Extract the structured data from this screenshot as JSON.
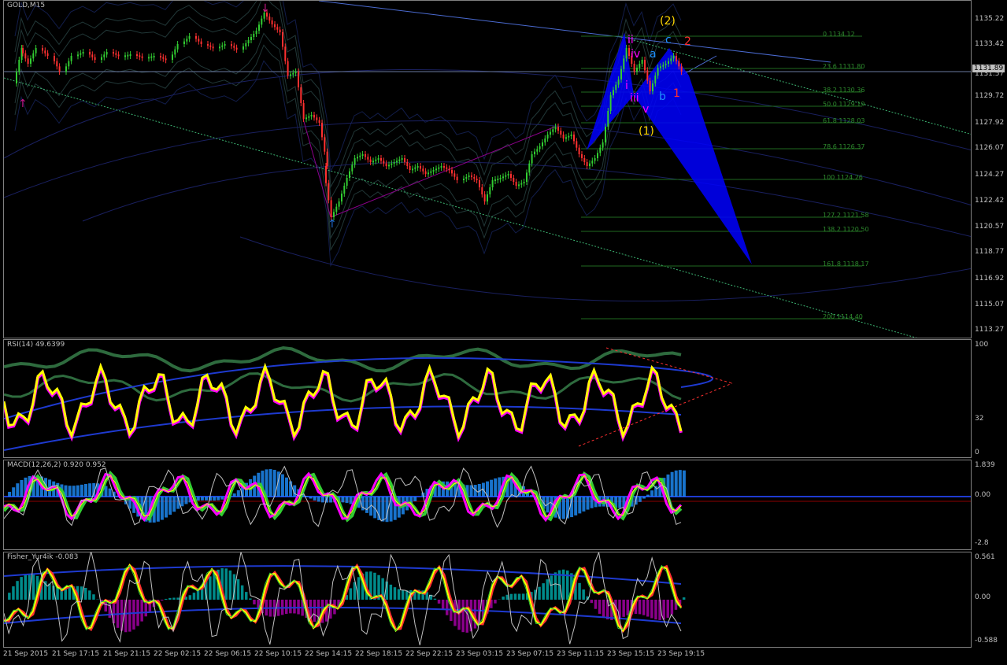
{
  "window": {
    "title": "GOLD,M15"
  },
  "current_price": "1131.89",
  "price_axis": [
    "1135.22",
    "1133.42",
    "1131.57",
    "1129.72",
    "1127.92",
    "1126.07",
    "1124.27",
    "1122.42",
    "1120.57",
    "1118.77",
    "1116.92",
    "1115.07",
    "1113.27"
  ],
  "fib_levels": [
    "0 1134.12",
    "23.6 1131.80",
    "38.2 1130.36",
    "50.0 1129.19",
    "61.8 1128.03",
    "78.6 1126.37",
    "100 1124.26",
    "127.2 1121.58",
    "138.2 1120.50",
    "161.8 1118.17",
    "200 1114.40"
  ],
  "wave_labels": [
    {
      "text": "(2)",
      "color": "#ffd700"
    },
    {
      "text": "c",
      "color": "#1e90ff"
    },
    {
      "text": "2",
      "color": "#ff3030"
    },
    {
      "text": "ii",
      "color": "#ff00ff"
    },
    {
      "text": "iv",
      "color": "#ff00ff"
    },
    {
      "text": "a",
      "color": "#1e90ff"
    },
    {
      "text": "i",
      "color": "#ff00ff"
    },
    {
      "text": "iii",
      "color": "#ff00ff"
    },
    {
      "text": "b",
      "color": "#1e90ff"
    },
    {
      "text": "1",
      "color": "#ff3030"
    },
    {
      "text": "v",
      "color": "#ff00ff"
    },
    {
      "text": "(1)",
      "color": "#ffd700"
    }
  ],
  "rsi": {
    "title": "RSI(14) 49.6399",
    "axis": [
      "100",
      "32",
      "0"
    ]
  },
  "macd": {
    "title": "MACD(12,26,2) 0.920 0.952",
    "axis": [
      "1.839",
      "0.00",
      "-2.8"
    ]
  },
  "fisher": {
    "title": "Fisher_Yur4ik -0.083",
    "axis": [
      "0.561",
      "0.00",
      "-0.588"
    ]
  },
  "time_axis": [
    "21 Sep 2015",
    "21 Sep 17:15",
    "21 Sep 21:15",
    "22 Sep 02:15",
    "22 Sep 06:15",
    "22 Sep 10:15",
    "22 Sep 14:15",
    "22 Sep 18:15",
    "22 Sep 22:15",
    "23 Sep 03:15",
    "23 Sep 07:15",
    "23 Sep 11:15",
    "23 Sep 15:15",
    "23 Sep 19:15"
  ],
  "colors": {
    "bull": "#32cd32",
    "bear": "#ff3030",
    "rsi_line": "#ffff00",
    "macd_hist": "#1e90ff",
    "fisher_pos": "#008b8b",
    "fisher_neg": "#8b008b",
    "pattern": "#0000ff"
  }
}
